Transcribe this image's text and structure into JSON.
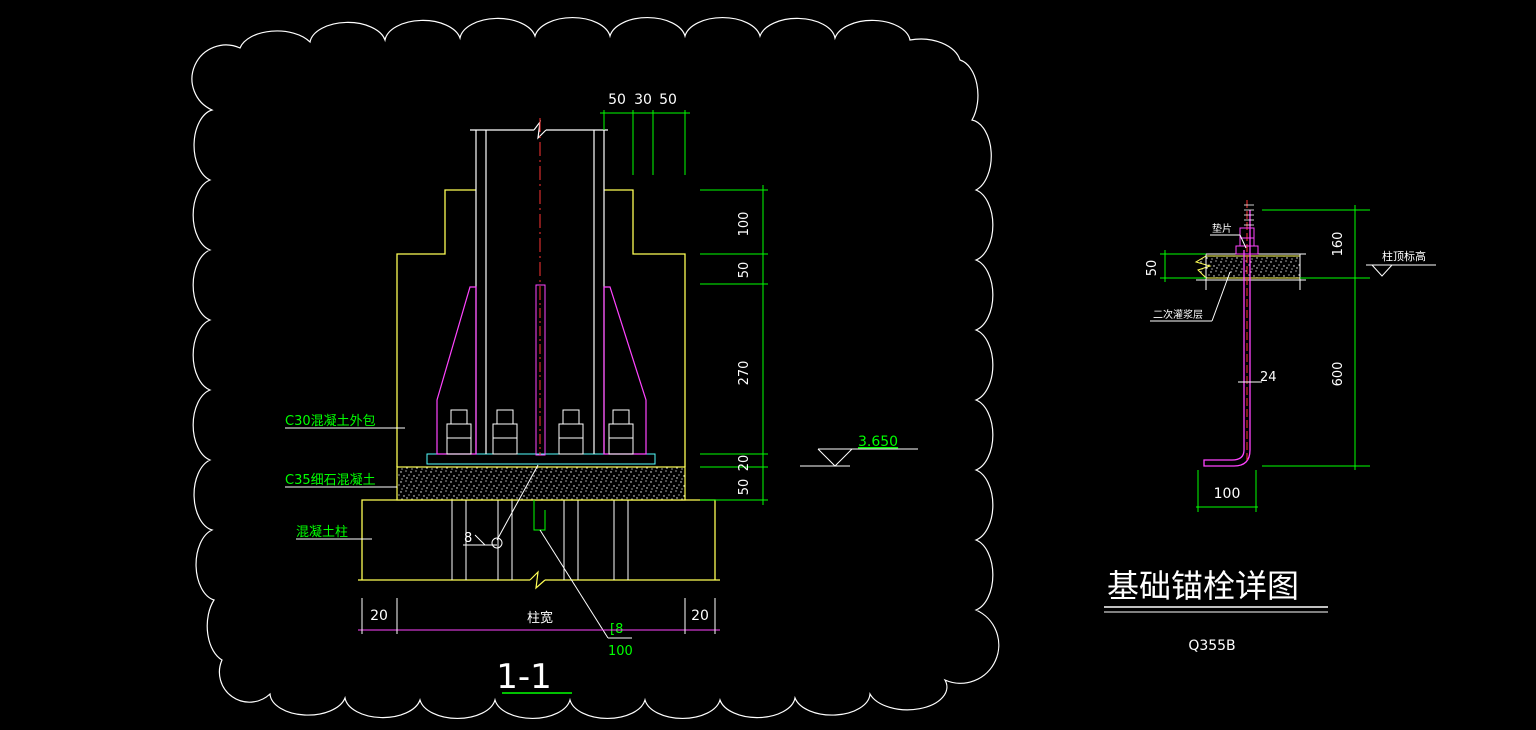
{
  "section": {
    "title": "1-1",
    "top_dims": [
      "50",
      "30",
      "50"
    ],
    "right_dims": [
      "100",
      "50",
      "270",
      "20",
      "50"
    ],
    "bottom_dims": {
      "left": "20",
      "center": "柱宽",
      "right": "20"
    },
    "labels": {
      "c30": "C30混凝土外包",
      "c35": "C35细石混凝土",
      "column": "混凝土柱"
    },
    "weld_size": "8",
    "plate_thk": "8",
    "plate_width": "100",
    "elevation": "3.650"
  },
  "detail": {
    "title": "基础锚栓详图",
    "material": "Q355B",
    "dims": {
      "top": "160",
      "left": "50",
      "main": "600",
      "bolt_dia": "24",
      "hook": "100"
    },
    "labels": {
      "washer": "垫片",
      "grout": "二次灌浆层",
      "column_top": "柱顶标高"
    }
  }
}
